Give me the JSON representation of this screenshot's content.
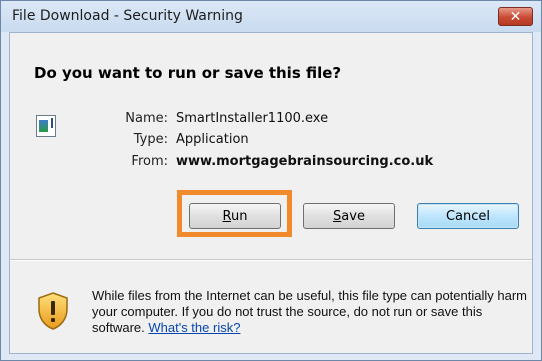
{
  "window": {
    "title": "File Download - Security Warning",
    "close_symbol": "✕"
  },
  "question": "Do you want to run or save this file?",
  "file_icon": "application-file-icon",
  "file_info": {
    "name_label": "Name:",
    "name_value": "SmartInstaller1100.exe",
    "type_label": "Type:",
    "type_value": "Application",
    "from_label": "From:",
    "from_value": "www.mortgagebrainsourcing.co.uk"
  },
  "buttons": {
    "run": {
      "access_key": "R",
      "rest": "un"
    },
    "save": {
      "access_key": "S",
      "rest": "ave"
    },
    "cancel": "Cancel"
  },
  "warning": {
    "icon": "security-shield-icon",
    "text": "While files from the Internet can be useful, this file type can potentially harm your computer. If you do not trust the source, do not run or save this software.",
    "link_text": "What's the risk?"
  },
  "colors": {
    "highlight": "#f08a2c",
    "link": "#0645ad",
    "close_button": "#c94a34"
  }
}
